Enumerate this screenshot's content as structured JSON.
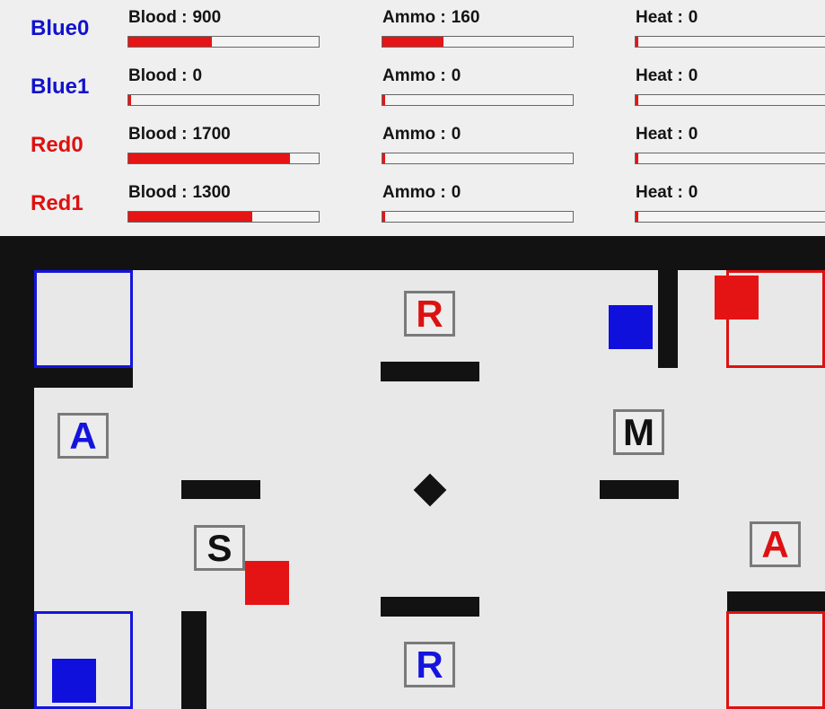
{
  "hud": {
    "robots": [
      {
        "name": "Blue0",
        "color": "blue",
        "blood": {
          "label": "Blood :",
          "value": "900",
          "fraction": 0.44
        },
        "ammo": {
          "label": "Ammo :",
          "value": "160",
          "fraction": 0.32
        },
        "heat": {
          "label": "Heat :",
          "value": "0",
          "fraction": 0
        }
      },
      {
        "name": "Blue1",
        "color": "blue",
        "blood": {
          "label": "Blood :",
          "value": "0",
          "fraction": 0
        },
        "ammo": {
          "label": "Ammo :",
          "value": "0",
          "fraction": 0
        },
        "heat": {
          "label": "Heat :",
          "value": "0",
          "fraction": 0
        }
      },
      {
        "name": "Red0",
        "color": "red",
        "blood": {
          "label": "Blood :",
          "value": "1700",
          "fraction": 0.85
        },
        "ammo": {
          "label": "Ammo :",
          "value": "0",
          "fraction": 0
        },
        "heat": {
          "label": "Heat :",
          "value": "0",
          "fraction": 0
        }
      },
      {
        "name": "Red1",
        "color": "red",
        "blood": {
          "label": "Blood :",
          "value": "1300",
          "fraction": 0.65
        },
        "ammo": {
          "label": "Ammo :",
          "value": "0",
          "fraction": 0
        },
        "heat": {
          "label": "Heat :",
          "value": "0",
          "fraction": 0
        }
      }
    ]
  },
  "arena": {
    "markers": {
      "r_top": "R",
      "r_bottom": "R",
      "a_left": "A",
      "a_right": "A",
      "m": "M",
      "s": "S"
    }
  },
  "colors": {
    "blue": "#1414dd",
    "red": "#e51515",
    "wall": "#121212",
    "floor": "#e8e8e8"
  }
}
